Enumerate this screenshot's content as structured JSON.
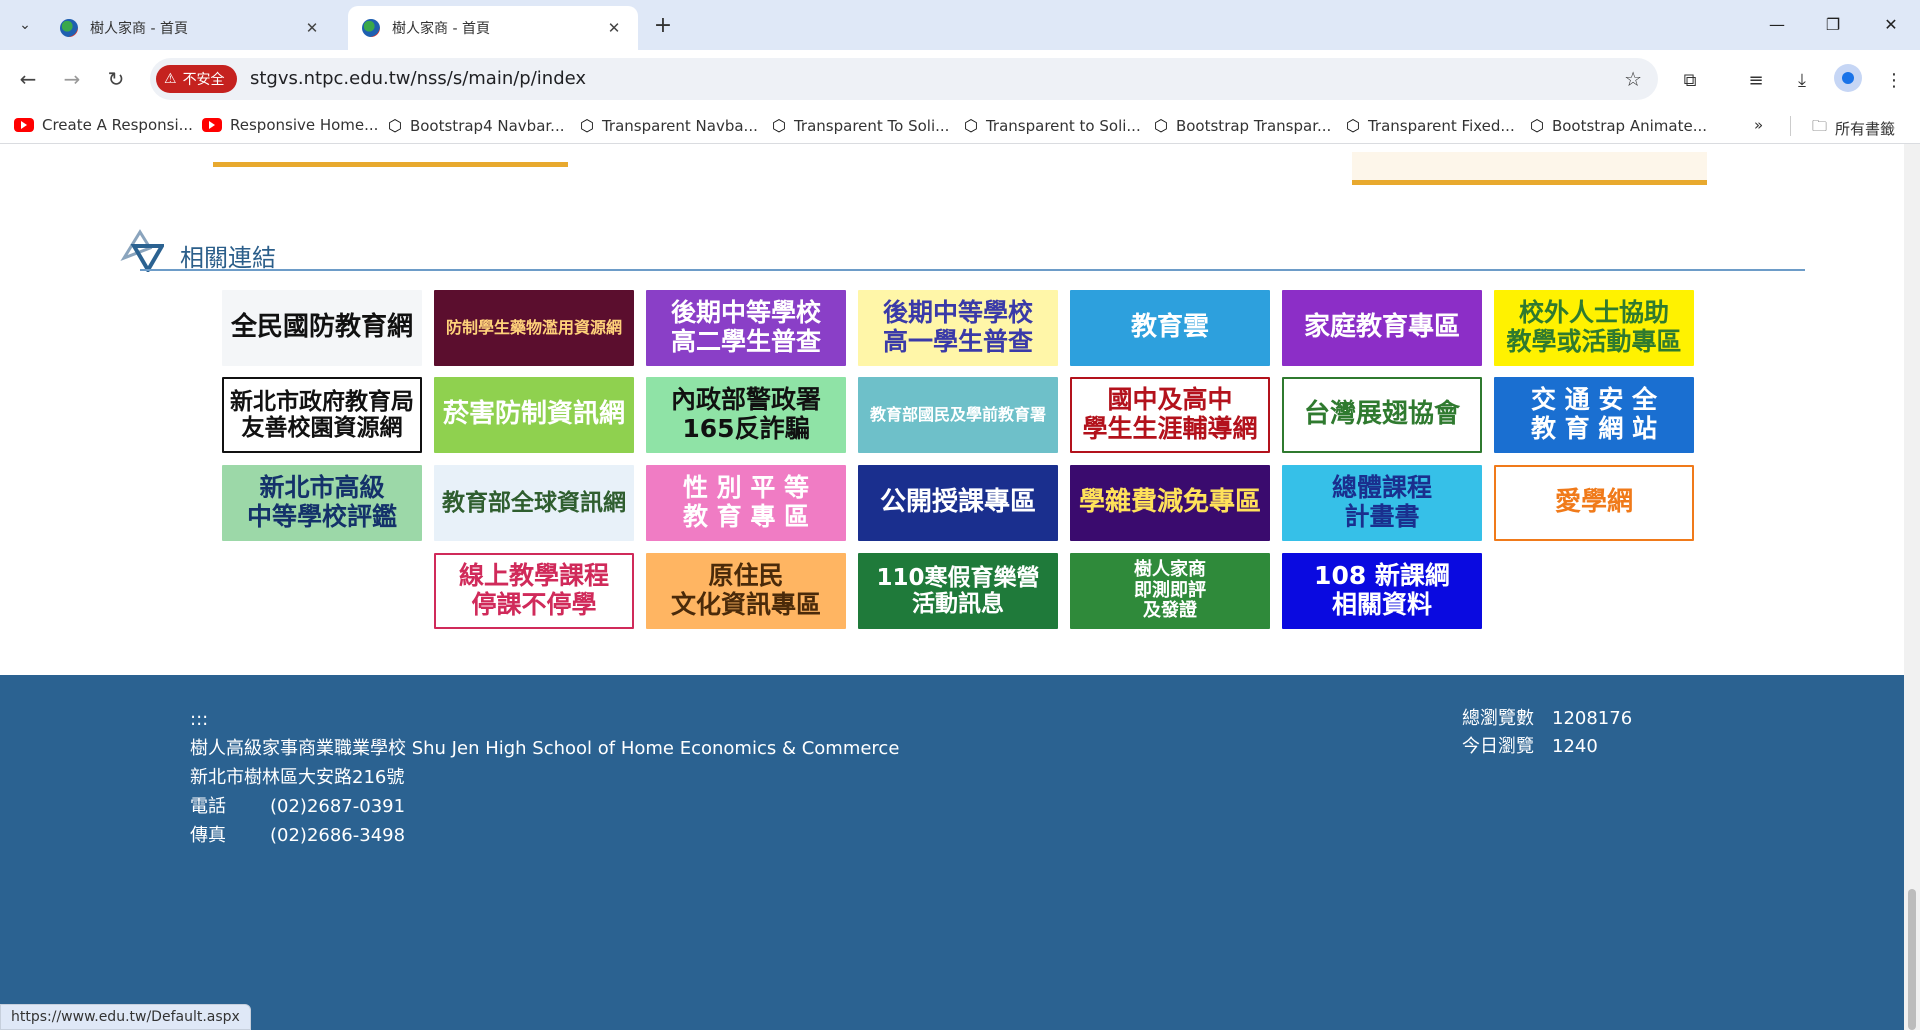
{
  "browser": {
    "tabs": [
      {
        "title": "樹人家商 - 首頁",
        "active": false
      },
      {
        "title": "樹人家商 - 首頁",
        "active": true
      }
    ],
    "security_label": "不安全",
    "url": "stgvs.ntpc.edu.tw/nss/s/main/p/index",
    "bookmarks": [
      {
        "label": "Create A Responsi...",
        "icon": "youtube-icon"
      },
      {
        "label": "Responsive Home...",
        "icon": "youtube-icon"
      },
      {
        "label": "Bootstrap4 Navbar...",
        "icon": "codepen-icon"
      },
      {
        "label": "Transparent Navba...",
        "icon": "codepen-icon"
      },
      {
        "label": "Transparent To Soli...",
        "icon": "codepen-icon"
      },
      {
        "label": "Transparent to Soli...",
        "icon": "codepen-icon"
      },
      {
        "label": "Bootstrap Transpar...",
        "icon": "codepen-icon"
      },
      {
        "label": "Transparent Fixed...",
        "icon": "codepen-icon"
      },
      {
        "label": "Bootstrap Animate...",
        "icon": "codepen-icon"
      }
    ],
    "all_bookmarks_label": "所有書籤",
    "status_url": "https://www.edu.tw/Default.aspx"
  },
  "section": {
    "title": "相關連結"
  },
  "links": [
    {
      "text": "全民國防教育網",
      "bg": "#f4f6f8",
      "fg": "#111111"
    },
    {
      "text": "防制學生藥物濫用資源網",
      "bg": "#5b0e2e",
      "fg": "#ffd27a"
    },
    {
      "text": "後期中等學校\n高二學生普查",
      "bg": "#8a3fc7",
      "fg": "#ffffff"
    },
    {
      "text": "後期中等學校\n高一學生普查",
      "bg": "#fff6a8",
      "fg": "#3a3aa8"
    },
    {
      "text": "教育雲",
      "bg": "#2da0dd",
      "fg": "#ffffff"
    },
    {
      "text": "家庭教育專區",
      "bg": "#8c2ec7",
      "fg": "#ffffff"
    },
    {
      "text": "校外人士協助\n教學或活動專區",
      "bg": "#fff200",
      "fg": "#2f7a2f"
    },
    {
      "text": "新北市政府教育局\n友善校園資源網",
      "bg": "#ffffff",
      "fg": "#111111"
    },
    {
      "text": "菸害防制資訊網",
      "bg": "#8fd14f",
      "fg": "#ffffff"
    },
    {
      "text": "內政部警政署\n165反詐騙",
      "bg": "#8fe3a6",
      "fg": "#111111"
    },
    {
      "text": "教育部國民及學前教育署",
      "bg": "#6ec0c9",
      "fg": "#ffffff"
    },
    {
      "text": "國中及高中\n學生生涯輔導網",
      "bg": "#ffffff",
      "fg": "#b3121c"
    },
    {
      "text": "台灣展翅協會",
      "bg": "#ffffff",
      "fg": "#2f7a2f"
    },
    {
      "text": "交 通 安 全\n教 育 網 站",
      "bg": "#1a6fd1",
      "fg": "#ffffff"
    },
    {
      "text": "新北市高級\n中等學校評鑑",
      "bg": "#9cd8a8",
      "fg": "#14326a"
    },
    {
      "text": "教育部全球資訊網",
      "bg": "#e8f1f9",
      "fg": "#2f5e2f"
    },
    {
      "text": "性 別 平 等\n教 育 專 區",
      "bg": "#f07cc4",
      "fg": "#ffffff"
    },
    {
      "text": "公開授課專區",
      "bg": "#1a2f8e",
      "fg": "#ffffff"
    },
    {
      "text": "學雜費減免專區",
      "bg": "#3a0b6e",
      "fg": "#ffe25a"
    },
    {
      "text": "總體課程\n計畫書",
      "bg": "#36c0e8",
      "fg": "#1a2f8e"
    },
    {
      "text": "愛學網",
      "bg": "#ffffff",
      "fg": "#f07a1a"
    },
    {
      "text": "線上教學課程\n停課不停學",
      "bg": "#ffffff",
      "fg": "#d02a5a"
    },
    {
      "text": "原住民\n文化資訊專區",
      "bg": "#ffb562",
      "fg": "#4a2a0a"
    },
    {
      "text": "110寒假育樂營\n活動訊息",
      "bg": "#1f7a3a",
      "fg": "#ffffff"
    },
    {
      "text": "樹人家商\n即測即評\n及發證",
      "bg": "#2f8a3a",
      "fg": "#ffffff"
    },
    {
      "text": "108 新課綱\n相關資料",
      "bg": "#0a0ae0",
      "fg": "#ffffff"
    }
  ],
  "footer": {
    "accesskey": ":::",
    "school_name": "樹人高級家事商業職業學校 Shu Jen High School of Home Economics & Commerce",
    "address": "新北市樹林區大安路216號",
    "phone_label": "電話",
    "phone": "(02)2687-0391",
    "fax_label": "傳真",
    "fax": "(02)2686-3498",
    "total_views_label": "總瀏覽數",
    "total_views": "1208176",
    "today_views_label": "今日瀏覽",
    "today_views": "1240"
  }
}
